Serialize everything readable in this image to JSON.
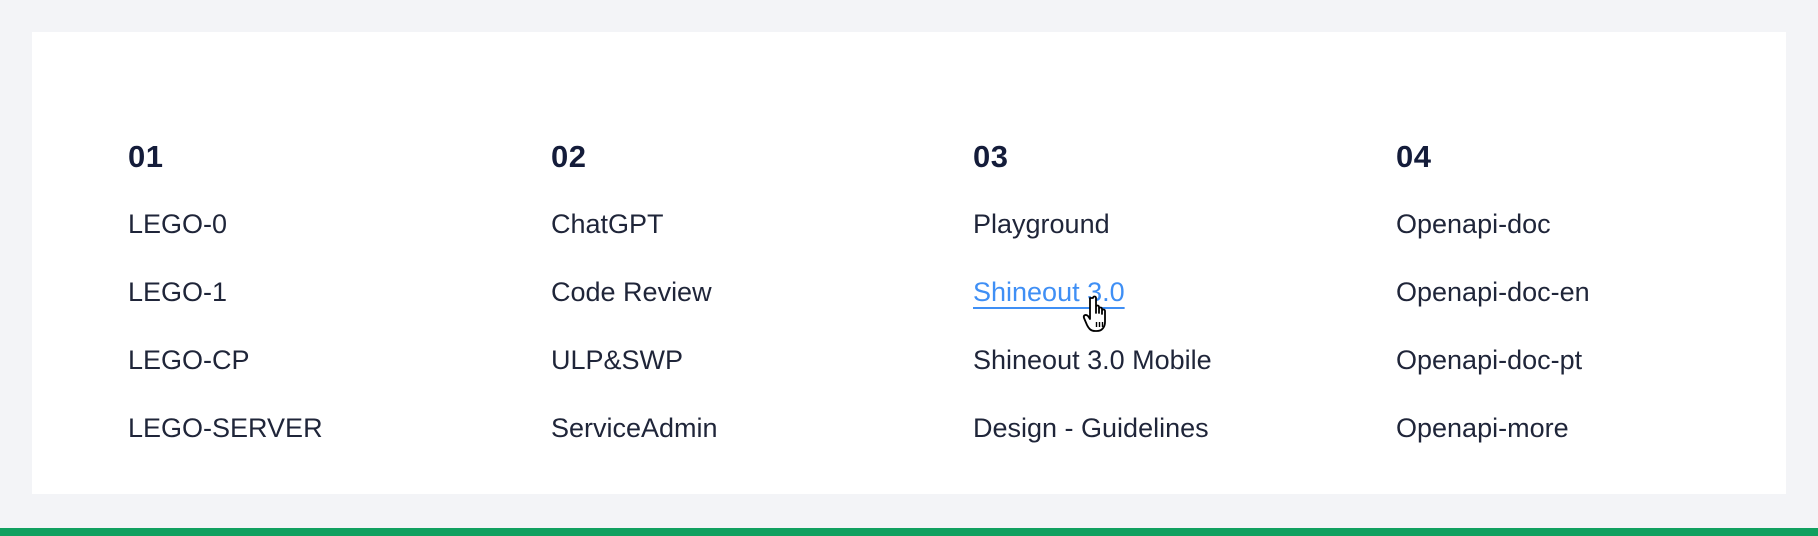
{
  "columns": [
    {
      "heading": "01",
      "links": [
        "LEGO-0",
        "LEGO-1",
        "LEGO-CP",
        "LEGO-SERVER"
      ]
    },
    {
      "heading": "02",
      "links": [
        "ChatGPT",
        "Code Review",
        "ULP&SWP",
        "ServiceAdmin"
      ]
    },
    {
      "heading": "03",
      "links": [
        "Playground",
        "Shineout 3.0",
        "Shineout 3.0 Mobile",
        "Design - Guidelines"
      ]
    },
    {
      "heading": "04",
      "links": [
        "Openapi-doc",
        "Openapi-doc-en",
        "Openapi-doc-pt",
        "Openapi-more"
      ]
    }
  ],
  "hovered_link": "Shineout 3.0",
  "colors": {
    "page_background": "#f3f4f7",
    "panel_background": "#ffffff",
    "text": "#1f2539",
    "heading": "#141c3a",
    "link_hover": "#3f8ff5",
    "footer_bar": "#10a060"
  },
  "icons": {
    "cursor": "hand-pointer-cursor-icon"
  }
}
